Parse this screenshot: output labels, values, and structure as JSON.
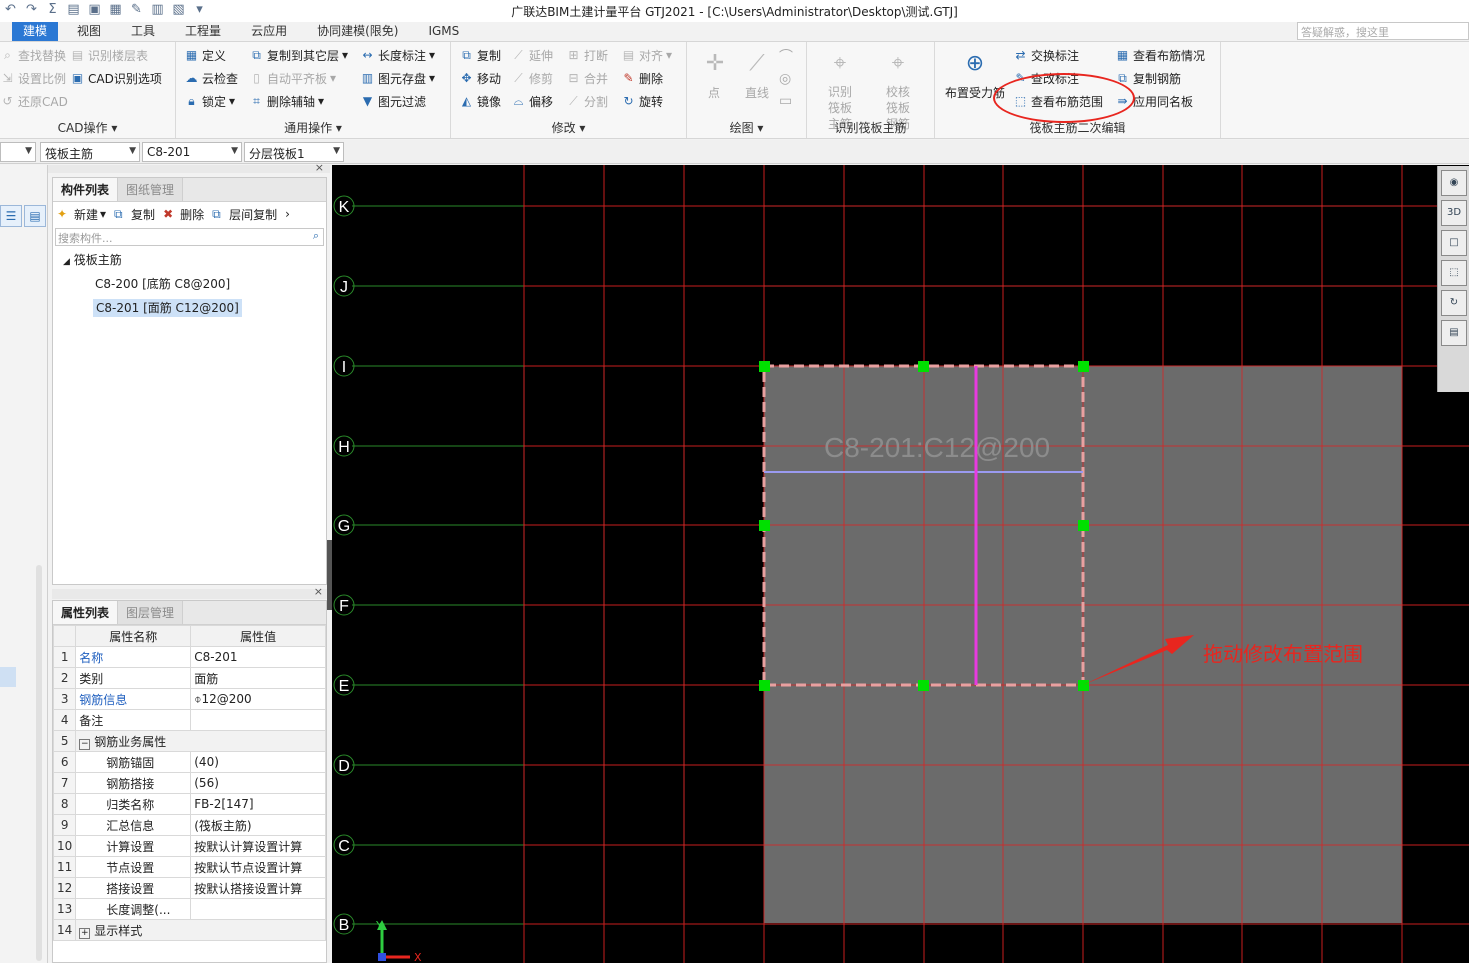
{
  "app": {
    "title": "广联达BIM土建计量平台 GTJ2021 - [C:\\Users\\Administrator\\Desktop\\测试.GTJ]",
    "help_placeholder": "答疑解惑，搜这里"
  },
  "tabs": [
    "建模",
    "视图",
    "工具",
    "工程量",
    "云应用",
    "协同建模(限免)",
    "IGMS"
  ],
  "ribbon": {
    "cad": {
      "label": "CAD操作",
      "items": [
        "查找替换",
        "识别楼层表",
        "设置比例",
        "CAD识别选项",
        "还原CAD"
      ]
    },
    "common": {
      "label": "通用操作",
      "items": [
        "定义",
        "复制到其它层",
        "长度标注",
        "云检查",
        "自动平齐板",
        "图元存盘",
        "锁定",
        "删除辅轴",
        "图元过滤"
      ]
    },
    "modify": {
      "label": "修改",
      "items": [
        "复制",
        "延伸",
        "打断",
        "对齐",
        "移动",
        "修剪",
        "合并",
        "删除",
        "镜像",
        "偏移",
        "分割",
        "旋转"
      ]
    },
    "draw": {
      "label": "绘图",
      "items": [
        "点",
        "直线"
      ]
    },
    "recognize": {
      "label": "识别筏板主筋",
      "items": [
        "识别筏板主筋",
        "校核筏板钢筋"
      ]
    },
    "edit2": {
      "label": "筏板主筋二次编辑",
      "big": "布置受力筋",
      "items": [
        "交换标注",
        "查看布筋情况",
        "查改标注",
        "复制钢筋",
        "查看布筋范围",
        "应用同名板"
      ]
    }
  },
  "selectors": [
    "筏板主筋",
    "C8-201",
    "分层筏板1"
  ],
  "component_panel": {
    "tabs": [
      "构件列表",
      "图纸管理"
    ],
    "toolbar": [
      "新建",
      "复制",
      "删除",
      "层间复制"
    ],
    "search_placeholder": "搜索构件...",
    "tree_root": "筏板主筋",
    "items": [
      "C8-200 [底筋 C8@200]",
      "C8-201 [面筋 C12@200]"
    ]
  },
  "property_panel": {
    "tabs": [
      "属性列表",
      "图层管理"
    ],
    "headers": [
      "属性名称",
      "属性值"
    ],
    "rows": [
      {
        "n": "1",
        "name": "名称",
        "value": "C8-201"
      },
      {
        "n": "2",
        "name": "类别",
        "value": "面筋"
      },
      {
        "n": "3",
        "name": "钢筋信息",
        "value": "⌽12@200"
      },
      {
        "n": "4",
        "name": "备注",
        "value": ""
      },
      {
        "n": "5",
        "name": "钢筋业务属性",
        "value": ""
      },
      {
        "n": "6",
        "name": "钢筋锚固",
        "value": "(40)"
      },
      {
        "n": "7",
        "name": "钢筋搭接",
        "value": "(56)"
      },
      {
        "n": "8",
        "name": "归类名称",
        "value": "FB-2[147]"
      },
      {
        "n": "9",
        "name": "汇总信息",
        "value": "(筏板主筋)"
      },
      {
        "n": "10",
        "name": "计算设置",
        "value": "按默认计算设置计算"
      },
      {
        "n": "11",
        "name": "节点设置",
        "value": "按默认节点设置计算"
      },
      {
        "n": "12",
        "name": "搭接设置",
        "value": "按默认搭接设置计算"
      },
      {
        "n": "13",
        "name": "长度调整(...",
        "value": ""
      },
      {
        "n": "14",
        "name": "显示样式",
        "value": ""
      }
    ]
  },
  "canvas": {
    "axis_labels": [
      "K",
      "J",
      "I",
      "H",
      "G",
      "F",
      "E",
      "D",
      "C",
      "B"
    ],
    "rebar_label": "C8-201:C12@200",
    "annotation": "拖动修改布置范围",
    "axis_x": "X",
    "axis_y": "Y"
  }
}
